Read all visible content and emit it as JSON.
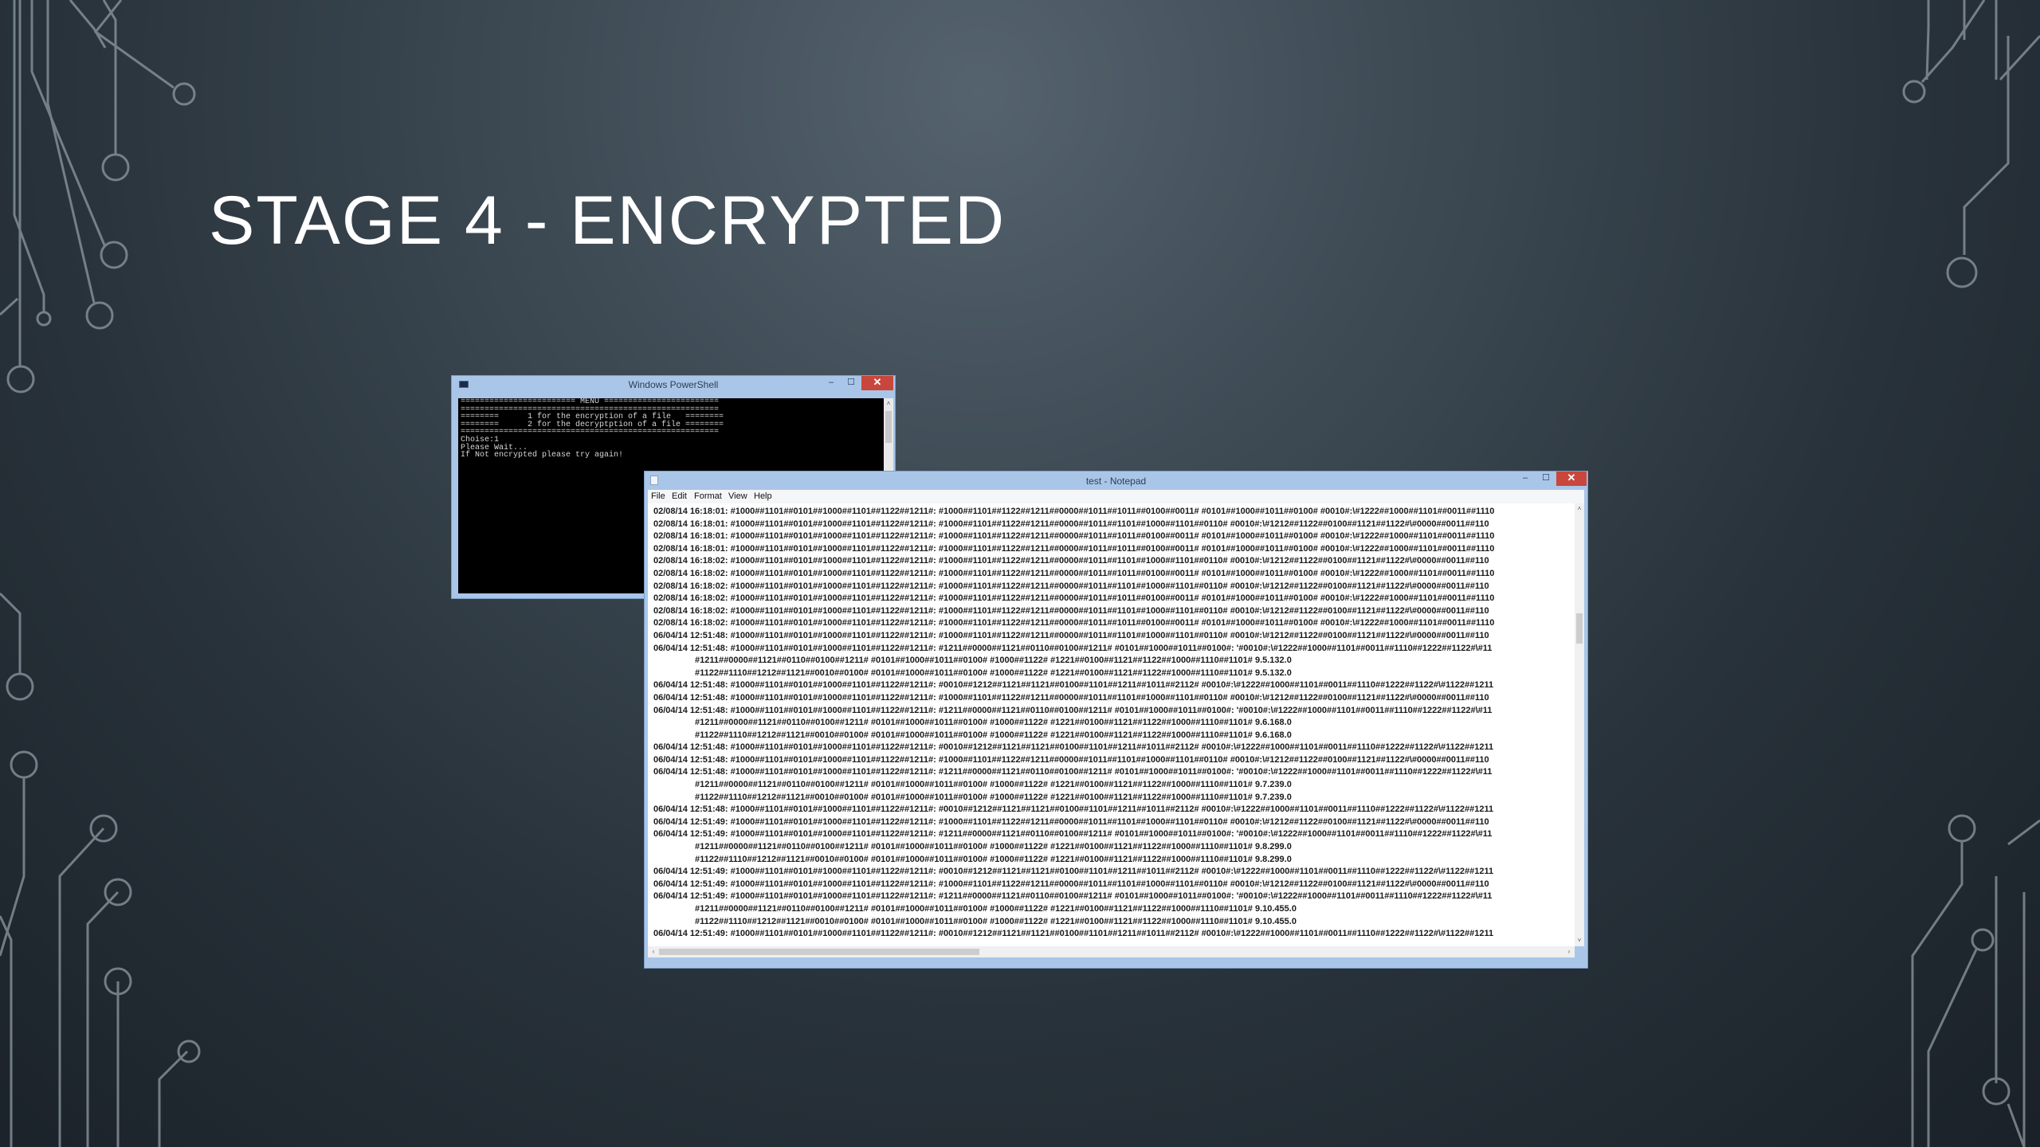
{
  "slide": {
    "title": "STAGE 4 - ENCRYPTED"
  },
  "powershell": {
    "title": "Windows PowerShell",
    "window_buttons": {
      "minimize": "–",
      "maximize": "☐",
      "close": "✕"
    },
    "console_lines": [
      "======================== MENU ========================",
      "======================================================",
      "========      1 for the encryption of a file   ========",
      "========      2 for the decryptption of a file ========",
      "======================================================",
      "Choise:1",
      "Please Wait...",
      "If Not encrypted please try again!"
    ]
  },
  "notepad": {
    "title": "test - Notepad",
    "window_buttons": {
      "minimize": "–",
      "maximize": "☐",
      "close": "✕"
    },
    "menu": [
      "File",
      "Edit",
      "Format",
      "View",
      "Help"
    ],
    "lines": [
      {
        "text": "02/08/14 16:18:01: #1000##1101##0101##1000##1101##1122##1211#: #1000##1101##1122##1211##0000##1011##1011##0100##0011# #0101##1000##1011##0100# #0010#:\\#1222##1000##1101##0011##1110",
        "cont": false
      },
      {
        "text": "02/08/14 16:18:01: #1000##1101##0101##1000##1101##1122##1211#: #1000##1101##1122##1211##0000##1011##1101##1000##1101##0110# #0010#:\\#1212##1122##0100##1121##1122#\\#0000##0011##110",
        "cont": false
      },
      {
        "text": "02/08/14 16:18:01: #1000##1101##0101##1000##1101##1122##1211#: #1000##1101##1122##1211##0000##1011##1011##0100##0011# #0101##1000##1011##0100# #0010#:\\#1222##1000##1101##0011##1110",
        "cont": false
      },
      {
        "text": "02/08/14 16:18:01: #1000##1101##0101##1000##1101##1122##1211#: #1000##1101##1122##1211##0000##1011##1011##0100##0011# #0101##1000##1011##0100# #0010#:\\#1222##1000##1101##0011##1110",
        "cont": false
      },
      {
        "text": "02/08/14 16:18:02: #1000##1101##0101##1000##1101##1122##1211#: #1000##1101##1122##1211##0000##1011##1101##1000##1101##0110# #0010#:\\#1212##1122##0100##1121##1122#\\#0000##0011##110",
        "cont": false
      },
      {
        "text": "02/08/14 16:18:02: #1000##1101##0101##1000##1101##1122##1211#: #1000##1101##1122##1211##0000##1011##1011##0100##0011# #0101##1000##1011##0100# #0010#:\\#1222##1000##1101##0011##1110",
        "cont": false
      },
      {
        "text": "02/08/14 16:18:02: #1000##1101##0101##1000##1101##1122##1211#: #1000##1101##1122##1211##0000##1011##1101##1000##1101##0110# #0010#:\\#1212##1122##0100##1121##1122#\\#0000##0011##110",
        "cont": false
      },
      {
        "text": "02/08/14 16:18:02: #1000##1101##0101##1000##1101##1122##1211#: #1000##1101##1122##1211##0000##1011##1011##0100##0011# #0101##1000##1011##0100# #0010#:\\#1222##1000##1101##0011##1110",
        "cont": false
      },
      {
        "text": "02/08/14 16:18:02: #1000##1101##0101##1000##1101##1122##1211#: #1000##1101##1122##1211##0000##1011##1101##1000##1101##0110# #0010#:\\#1212##1122##0100##1121##1122#\\#0000##0011##110",
        "cont": false
      },
      {
        "text": "02/08/14 16:18:02: #1000##1101##0101##1000##1101##1122##1211#: #1000##1101##1122##1211##0000##1011##1011##0100##0011# #0101##1000##1011##0100# #0010#:\\#1222##1000##1101##0011##1110",
        "cont": false
      },
      {
        "text": "06/04/14 12:51:48: #1000##1101##0101##1000##1101##1122##1211#: #1000##1101##1122##1211##0000##1011##1101##1000##1101##0110# #0010#:\\#1212##1122##0100##1121##1122#\\#0000##0011##110",
        "cont": false
      },
      {
        "text": "06/04/14 12:51:48: #1000##1101##0101##1000##1101##1122##1211#: #1211##0000##1121##0110##0100##1211# #0101##1000##1011##0100#: '#0010#:\\#1222##1000##1101##0011##1110##1222##1122#\\#11",
        "cont": false
      },
      {
        "text": "#1211##0000##1121##0110##0100##1211# #0101##1000##1011##0100# #1000##1122# #1221##0100##1121##1122##1000##1110##1101# 9.5.132.0",
        "cont": true
      },
      {
        "text": "#1122##1110##1212##1121##0010##0100# #0101##1000##1011##0100# #1000##1122# #1221##0100##1121##1122##1000##1110##1101# 9.5.132.0",
        "cont": true
      },
      {
        "text": "06/04/14 12:51:48: #1000##1101##0101##1000##1101##1122##1211#: #0010##1212##1121##1121##0100##1101##1211##1011##2112# #0010#:\\#1222##1000##1101##0011##1110##1222##1122#\\#1122##1211",
        "cont": false
      },
      {
        "text": "06/04/14 12:51:48: #1000##1101##0101##1000##1101##1122##1211#: #1000##1101##1122##1211##0000##1011##1101##1000##1101##0110# #0010#:\\#1212##1122##0100##1121##1122#\\#0000##0011##110",
        "cont": false
      },
      {
        "text": "06/04/14 12:51:48: #1000##1101##0101##1000##1101##1122##1211#: #1211##0000##1121##0110##0100##1211# #0101##1000##1011##0100#: '#0010#:\\#1222##1000##1101##0011##1110##1222##1122#\\#11",
        "cont": false
      },
      {
        "text": "#1211##0000##1121##0110##0100##1211# #0101##1000##1011##0100# #1000##1122# #1221##0100##1121##1122##1000##1110##1101# 9.6.168.0",
        "cont": true
      },
      {
        "text": "#1122##1110##1212##1121##0010##0100# #0101##1000##1011##0100# #1000##1122# #1221##0100##1121##1122##1000##1110##1101# 9.6.168.0",
        "cont": true
      },
      {
        "text": "06/04/14 12:51:48: #1000##1101##0101##1000##1101##1122##1211#: #0010##1212##1121##1121##0100##1101##1211##1011##2112# #0010#:\\#1222##1000##1101##0011##1110##1222##1122#\\#1122##1211",
        "cont": false
      },
      {
        "text": "06/04/14 12:51:48: #1000##1101##0101##1000##1101##1122##1211#: #1000##1101##1122##1211##0000##1011##1101##1000##1101##0110# #0010#:\\#1212##1122##0100##1121##1122#\\#0000##0011##110",
        "cont": false
      },
      {
        "text": "06/04/14 12:51:48: #1000##1101##0101##1000##1101##1122##1211#: #1211##0000##1121##0110##0100##1211# #0101##1000##1011##0100#: '#0010#:\\#1222##1000##1101##0011##1110##1222##1122#\\#11",
        "cont": false
      },
      {
        "text": "#1211##0000##1121##0110##0100##1211# #0101##1000##1011##0100# #1000##1122# #1221##0100##1121##1122##1000##1110##1101# 9.7.239.0",
        "cont": true
      },
      {
        "text": "#1122##1110##1212##1121##0010##0100# #0101##1000##1011##0100# #1000##1122# #1221##0100##1121##1122##1000##1110##1101# 9.7.239.0",
        "cont": true
      },
      {
        "text": "06/04/14 12:51:48: #1000##1101##0101##1000##1101##1122##1211#: #0010##1212##1121##1121##0100##1101##1211##1011##2112# #0010#:\\#1222##1000##1101##0011##1110##1222##1122#\\#1122##1211",
        "cont": false
      },
      {
        "text": "06/04/14 12:51:49: #1000##1101##0101##1000##1101##1122##1211#: #1000##1101##1122##1211##0000##1011##1101##1000##1101##0110# #0010#:\\#1212##1122##0100##1121##1122#\\#0000##0011##110",
        "cont": false
      },
      {
        "text": "06/04/14 12:51:49: #1000##1101##0101##1000##1101##1122##1211#: #1211##0000##1121##0110##0100##1211# #0101##1000##1011##0100#: '#0010#:\\#1222##1000##1101##0011##1110##1222##1122#\\#11",
        "cont": false
      },
      {
        "text": "#1211##0000##1121##0110##0100##1211# #0101##1000##1011##0100# #1000##1122# #1221##0100##1121##1122##1000##1110##1101# 9.8.299.0",
        "cont": true
      },
      {
        "text": "#1122##1110##1212##1121##0010##0100# #0101##1000##1011##0100# #1000##1122# #1221##0100##1121##1122##1000##1110##1101# 9.8.299.0",
        "cont": true
      },
      {
        "text": "06/04/14 12:51:49: #1000##1101##0101##1000##1101##1122##1211#: #0010##1212##1121##1121##0100##1101##1211##1011##2112# #0010#:\\#1222##1000##1101##0011##1110##1222##1122#\\#1122##1211",
        "cont": false
      },
      {
        "text": "06/04/14 12:51:49: #1000##1101##0101##1000##1101##1122##1211#: #1000##1101##1122##1211##0000##1011##1101##1000##1101##0110# #0010#:\\#1212##1122##0100##1121##1122#\\#0000##0011##110",
        "cont": false
      },
      {
        "text": "06/04/14 12:51:49: #1000##1101##0101##1000##1101##1122##1211#: #1211##0000##1121##0110##0100##1211# #0101##1000##1011##0100#: '#0010#:\\#1222##1000##1101##0011##1110##1222##1122#\\#11",
        "cont": false
      },
      {
        "text": "#1211##0000##1121##0110##0100##1211# #0101##1000##1011##0100# #1000##1122# #1221##0100##1121##1122##1000##1110##1101# 9.10.455.0",
        "cont": true
      },
      {
        "text": "#1122##1110##1212##1121##0010##0100# #0101##1000##1011##0100# #1000##1122# #1221##0100##1121##1122##1000##1110##1101# 9.10.455.0",
        "cont": true
      },
      {
        "text": "06/04/14 12:51:49: #1000##1101##0101##1000##1101##1122##1211#: #0010##1212##1121##1121##0100##1101##1211##1011##2112# #0010#:\\#1222##1000##1101##0011##1110##1222##1122#\\#1122##1211",
        "cont": false
      }
    ],
    "scroll_arrows": {
      "up": "˄",
      "down": "˅",
      "left": "‹",
      "right": "›"
    }
  },
  "colors": {
    "title_text": "#ffffff",
    "circuit_lines": "#8e9aa4",
    "window_frame": "#a9c6e8",
    "close_button": "#c9463d",
    "console_bg": "#000000"
  }
}
